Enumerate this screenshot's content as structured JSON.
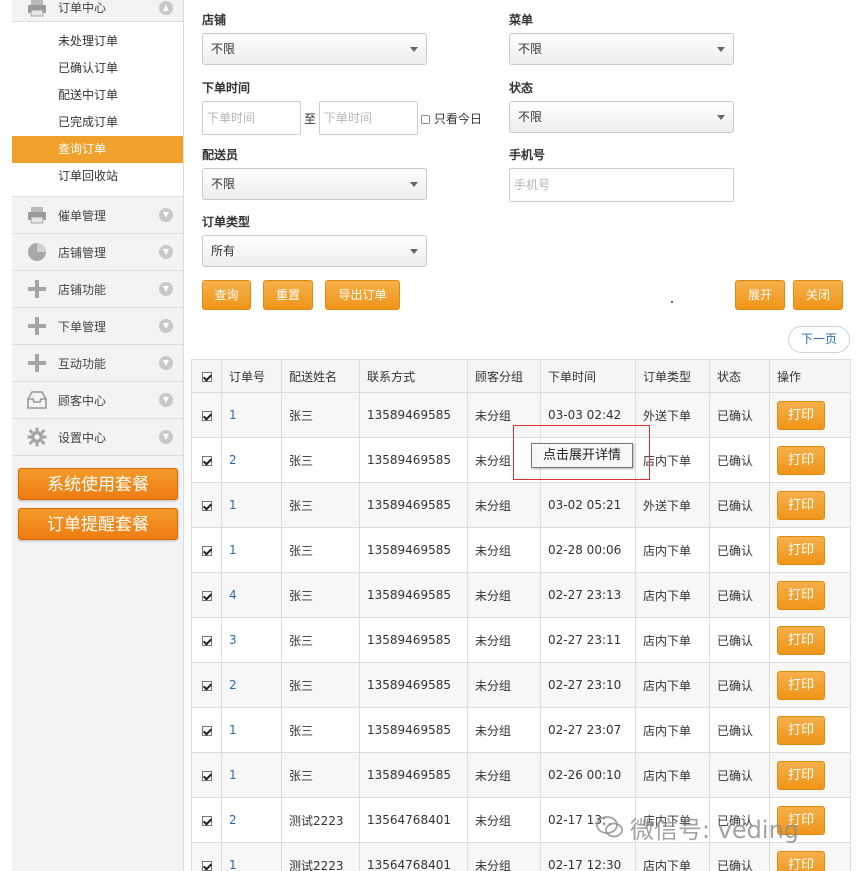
{
  "sidebar": {
    "sections": [
      {
        "label": "订单中心",
        "icon": "printer-icon",
        "expanded": true,
        "items": [
          {
            "label": "未处理订单"
          },
          {
            "label": "已确认订单"
          },
          {
            "label": "配送中订单"
          },
          {
            "label": "已完成订单"
          },
          {
            "label": "查询订单",
            "active": true
          },
          {
            "label": "订单回收站"
          }
        ]
      },
      {
        "label": "催单管理",
        "icon": "printer-icon"
      },
      {
        "label": "店铺管理",
        "icon": "pie-chart-icon"
      },
      {
        "label": "店铺功能",
        "icon": "plus-icon"
      },
      {
        "label": "下单管理",
        "icon": "plus-icon"
      },
      {
        "label": "互动功能",
        "icon": "plus-icon"
      },
      {
        "label": "顾客中心",
        "icon": "inbox-icon"
      },
      {
        "label": "设置中心",
        "icon": "gear-icon"
      }
    ],
    "packages": [
      "系统使用套餐",
      "订单提醒套餐"
    ]
  },
  "form": {
    "store": {
      "label": "店铺",
      "value": "不限"
    },
    "menu": {
      "label": "菜单",
      "value": "不限"
    },
    "order_time": {
      "label": "下单时间",
      "start_placeholder": "下单时间",
      "to": "至",
      "end_placeholder": "下单时间",
      "today_only": "只看今日"
    },
    "status": {
      "label": "状态",
      "value": "不限"
    },
    "courier": {
      "label": "配送员",
      "value": "不限"
    },
    "phone": {
      "label": "手机号",
      "placeholder": "手机号"
    },
    "order_type": {
      "label": "订单类型",
      "value": "所有"
    },
    "buttons": {
      "query": "查询",
      "reset": "重置",
      "export": "导出订单",
      "expand": "展开",
      "close": "关闭"
    },
    "next_page": "下一页"
  },
  "table": {
    "headers": [
      "订单号",
      "配送姓名",
      "联系方式",
      "顾客分组",
      "下单时间",
      "订单类型",
      "状态",
      "操作"
    ],
    "print_label": "打印",
    "rows": [
      {
        "id": "1",
        "name": "张三",
        "phone": "13589469585",
        "group": "未分组",
        "time": "03-03 02:42",
        "type": "外送下单",
        "status": "已确认"
      },
      {
        "id": "2",
        "name": "张三",
        "phone": "13589469585",
        "group": "未分组",
        "time": "",
        "type": "店内下单",
        "status": "已确认"
      },
      {
        "id": "1",
        "name": "张三",
        "phone": "13589469585",
        "group": "未分组",
        "time": "03-02 05:21",
        "type": "外送下单",
        "status": "已确认"
      },
      {
        "id": "1",
        "name": "张三",
        "phone": "13589469585",
        "group": "未分组",
        "time": "02-28 00:06",
        "type": "店内下单",
        "status": "已确认"
      },
      {
        "id": "4",
        "name": "张三",
        "phone": "13589469585",
        "group": "未分组",
        "time": "02-27 23:13",
        "type": "店内下单",
        "status": "已确认"
      },
      {
        "id": "3",
        "name": "张三",
        "phone": "13589469585",
        "group": "未分组",
        "time": "02-27 23:11",
        "type": "店内下单",
        "status": "已确认"
      },
      {
        "id": "2",
        "name": "张三",
        "phone": "13589469585",
        "group": "未分组",
        "time": "02-27 23:10",
        "type": "店内下单",
        "status": "已确认"
      },
      {
        "id": "1",
        "name": "张三",
        "phone": "13589469585",
        "group": "未分组",
        "time": "02-27 23:07",
        "type": "店内下单",
        "status": "已确认"
      },
      {
        "id": "1",
        "name": "张三",
        "phone": "13589469585",
        "group": "未分组",
        "time": "02-26 00:10",
        "type": "店内下单",
        "status": "已确认"
      },
      {
        "id": "2",
        "name": "测试2223",
        "phone": "13564768401",
        "group": "未分组",
        "time": "02-17 13:",
        "type": "店内下单",
        "status": "已确认"
      },
      {
        "id": "1",
        "name": "测试2223",
        "phone": "13564768401",
        "group": "未分组",
        "time": "02-17 12:30",
        "type": "店内下单",
        "status": "已确认"
      }
    ]
  },
  "tooltip": "点击展开详情",
  "watermark": "微信号: veding",
  "colors": {
    "accent": "#f0a12b",
    "link": "#2d6ab3",
    "annotation": "#e03030"
  }
}
